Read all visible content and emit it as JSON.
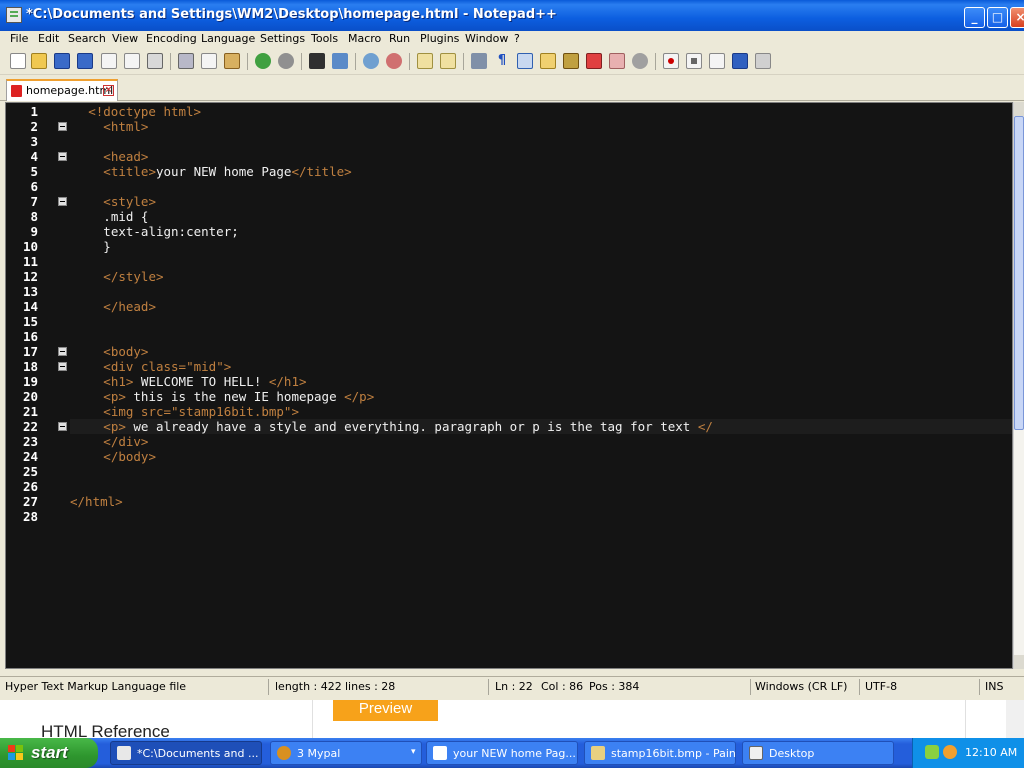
{
  "window": {
    "title": "*C:\\Documents and Settings\\WM2\\Desktop\\homepage.html - Notepad++",
    "min_glyph": "_",
    "max_glyph": "□",
    "close_glyph": "×"
  },
  "menu": [
    "File",
    "Edit",
    "Search",
    "View",
    "Encoding",
    "Language",
    "Settings",
    "Tools",
    "Macro",
    "Run",
    "Plugins",
    "Window",
    "?"
  ],
  "toolbar": {
    "icons": [
      "new-file-icon",
      "open-file-icon",
      "save-icon",
      "save-all-icon",
      "close-icon",
      "close-all-icon",
      "print-icon",
      "cut-icon",
      "copy-icon",
      "paste-icon",
      "undo-icon",
      "redo-icon",
      "find-icon",
      "replace-icon",
      "zoom-in-icon",
      "zoom-out-icon",
      "sync-v-icon",
      "sync-h-icon",
      "word-wrap-icon",
      "show-all-chars-icon",
      "indent-guide-icon",
      "udl-icon",
      "doc-map-icon",
      "function-list-icon",
      "folder-workspace-icon",
      "monitor-icon",
      "record-macro-icon",
      "stop-macro-icon",
      "play-macro-icon",
      "run-macro-multiple-icon",
      "save-macro-icon"
    ]
  },
  "tab": {
    "label": "homepage.html",
    "close_glyph": "×"
  },
  "editor": {
    "current_line": 22,
    "lines": [
      [
        [
          "tag",
          "<!doctype html>"
        ]
      ],
      [
        [
          "tag",
          "<html>"
        ]
      ],
      [
        [
          "tag",
          ""
        ]
      ],
      [
        [
          "tag",
          "<head>"
        ]
      ],
      [
        [
          "tag",
          "<title>"
        ],
        [
          "txt",
          "your NEW home Page"
        ],
        [
          "tag",
          "</title>"
        ]
      ],
      [],
      [
        [
          "tag",
          "<style>"
        ]
      ],
      [
        [
          "txt",
          ".mid {"
        ]
      ],
      [
        [
          "txt",
          "text-align:center;"
        ]
      ],
      [
        [
          "txt",
          "}"
        ]
      ],
      [],
      [
        [
          "tag",
          "</style>"
        ]
      ],
      [],
      [
        [
          "tag",
          "</head>"
        ]
      ],
      [],
      [],
      [
        [
          "tag",
          "<body>"
        ]
      ],
      [
        [
          "tag",
          "<div class="
        ],
        [
          "attrv",
          "\"mid\""
        ],
        [
          "tag",
          ">"
        ]
      ],
      [
        [
          "tag",
          "<h1>"
        ],
        [
          "txt",
          " WELCOME TO HELL! "
        ],
        [
          "tag",
          "</h1>"
        ]
      ],
      [
        [
          "tag",
          "<p>"
        ],
        [
          "txt",
          " this is the new IE homepage "
        ],
        [
          "tag",
          "</p>"
        ]
      ],
      [
        [
          "tag",
          "<img src="
        ],
        [
          "attrv",
          "\"stamp16bit.bmp\""
        ],
        [
          "tag",
          ">"
        ]
      ],
      [
        [
          "tag",
          "<p>"
        ],
        [
          "txt",
          " we already have a style and everything. paragraph or p is the tag for text "
        ],
        [
          "tag",
          "</"
        ]
      ],
      [
        [
          "tag",
          "</div>"
        ]
      ],
      [
        [
          "tag",
          "</body>"
        ]
      ],
      [],
      [],
      [
        [
          "tag",
          "</html>"
        ]
      ],
      []
    ],
    "indent": [
      2,
      3,
      3,
      3,
      3,
      3,
      3,
      3,
      3,
      3,
      3,
      3,
      3,
      3,
      3,
      3,
      3,
      3,
      3,
      3,
      3,
      3,
      3,
      3,
      3,
      3,
      0,
      0
    ],
    "fold_lines": [
      2,
      4,
      7,
      17,
      18,
      22
    ]
  },
  "status": {
    "file_type": "Hyper Text Markup Language file",
    "length": "length : 422",
    "lines": "lines : 28",
    "ln": "Ln : 22",
    "col": "Col : 86",
    "pos": "Pos : 384",
    "eol": "Windows (CR LF)",
    "encoding": "UTF-8",
    "mode": "INS"
  },
  "background_page": {
    "reference": "HTML Reference",
    "preview": "Preview"
  },
  "taskbar": {
    "start": "start",
    "tasks": [
      {
        "label": "*C:\\Documents and ...",
        "active": true
      },
      {
        "label": "3 Mypal",
        "active": false
      },
      {
        "label": "your NEW home Pag...",
        "active": false
      },
      {
        "label": "stamp16bit.bmp - Paint",
        "active": false
      },
      {
        "label": "Desktop",
        "active": false
      }
    ],
    "clock": "12:10 AM"
  },
  "colors": {
    "tag": "#c08040",
    "text": "#f0f0f0",
    "editor_bg": "#141414",
    "title_bar": "#0a5ad8",
    "taskbar": "#245edb"
  }
}
